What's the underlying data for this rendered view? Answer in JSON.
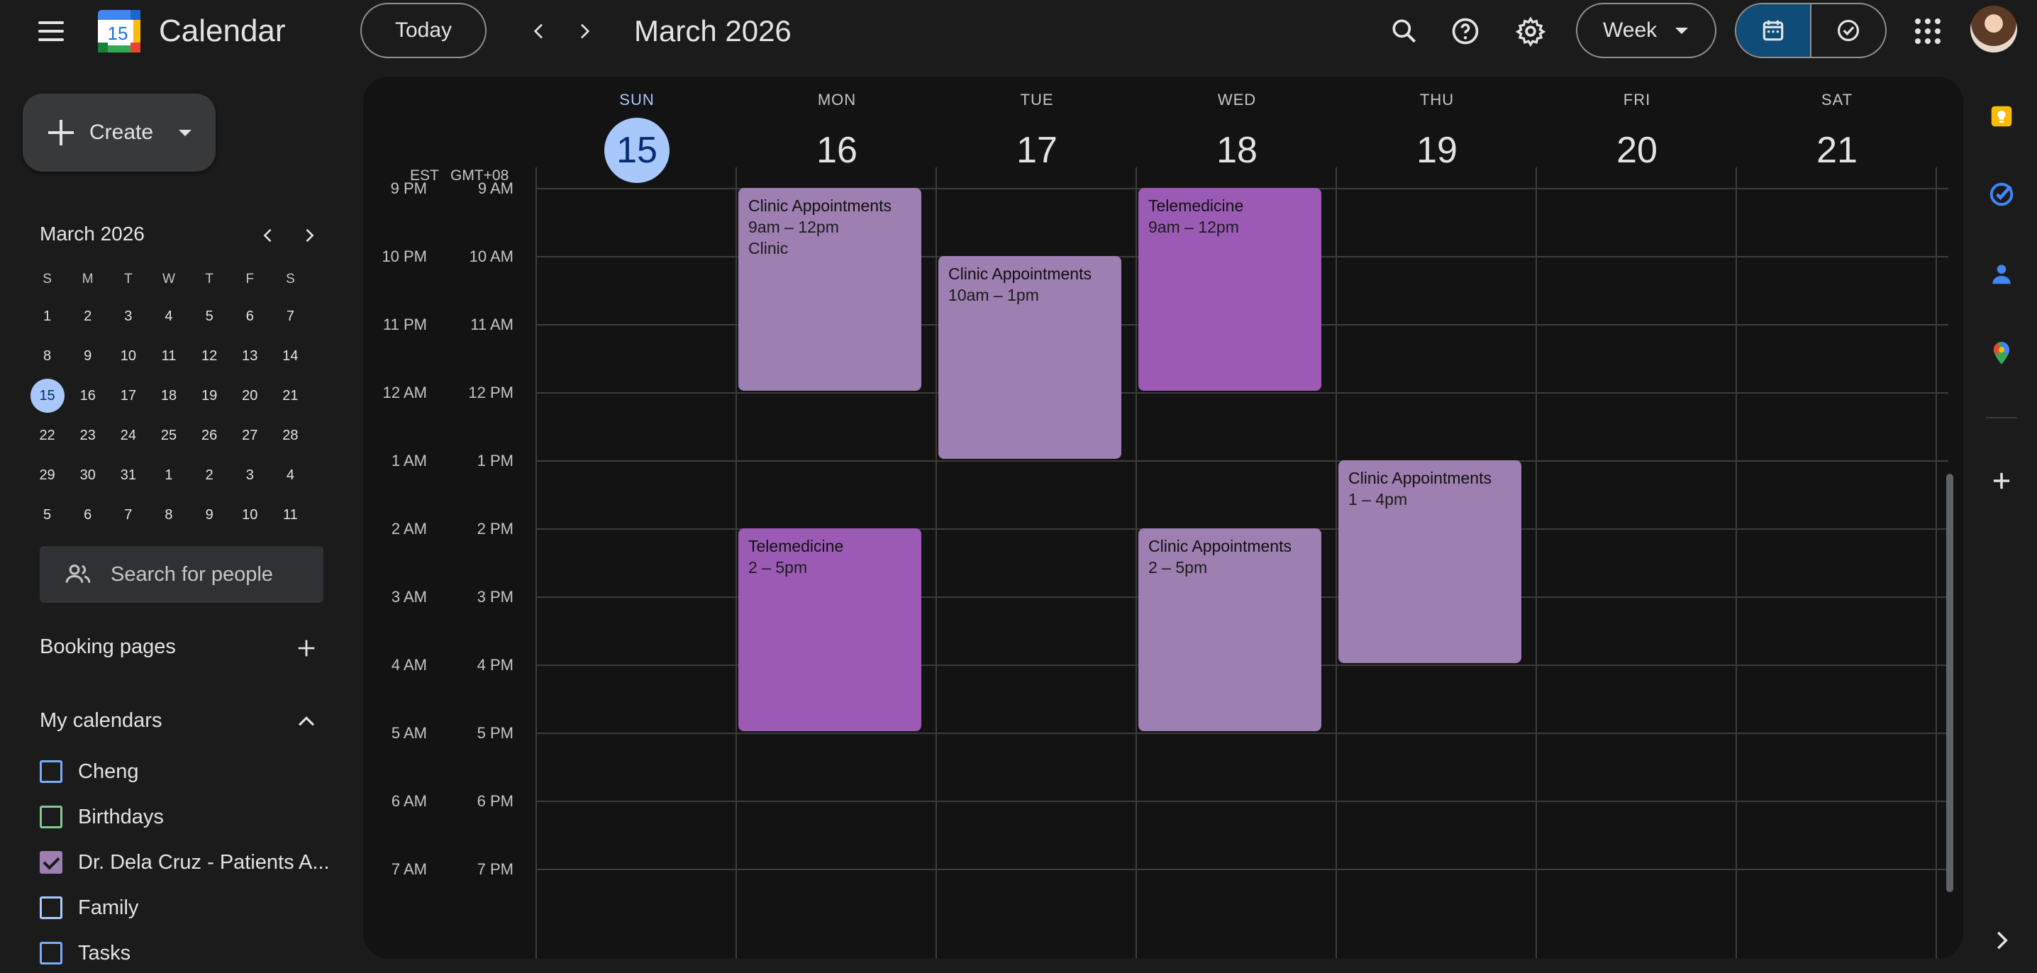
{
  "header": {
    "app_title": "Calendar",
    "logo_day": "15",
    "today_label": "Today",
    "period_title": "March 2026",
    "view_label": "Week",
    "icons": [
      "menu-icon",
      "search-icon",
      "help-icon",
      "settings-icon",
      "calendar-view-icon",
      "tasks-view-icon",
      "apps-grid-icon"
    ]
  },
  "sidebar": {
    "create_label": "Create",
    "mini_calendar": {
      "title": "March 2026",
      "weekdays": [
        "S",
        "M",
        "T",
        "W",
        "T",
        "F",
        "S"
      ],
      "weeks": [
        [
          "1",
          "2",
          "3",
          "4",
          "5",
          "6",
          "7"
        ],
        [
          "8",
          "9",
          "10",
          "11",
          "12",
          "13",
          "14"
        ],
        [
          "15",
          "16",
          "17",
          "18",
          "19",
          "20",
          "21"
        ],
        [
          "22",
          "23",
          "24",
          "25",
          "26",
          "27",
          "28"
        ],
        [
          "29",
          "30",
          "31",
          "1",
          "2",
          "3",
          "4"
        ],
        [
          "5",
          "6",
          "7",
          "8",
          "9",
          "10",
          "11"
        ]
      ],
      "today": "15"
    },
    "search_people_placeholder": "Search for people",
    "booking_pages_label": "Booking pages",
    "my_calendars_label": "My calendars",
    "calendars": [
      {
        "name": "Cheng",
        "color": "#7cacf8",
        "checked": false
      },
      {
        "name": "Birthdays",
        "color": "#81c995",
        "checked": false
      },
      {
        "name": "Dr. Dela Cruz - Patients A...",
        "color": "#9d7fb1",
        "checked": true
      },
      {
        "name": "Family",
        "color": "#aecbfa",
        "checked": false
      },
      {
        "name": "Tasks",
        "color": "#7cacf8",
        "checked": false
      }
    ]
  },
  "week": {
    "days": [
      {
        "dow": "SUN",
        "num": "15",
        "today": true
      },
      {
        "dow": "MON",
        "num": "16",
        "today": false
      },
      {
        "dow": "TUE",
        "num": "17",
        "today": false
      },
      {
        "dow": "WED",
        "num": "18",
        "today": false
      },
      {
        "dow": "THU",
        "num": "19",
        "today": false
      },
      {
        "dow": "FRI",
        "num": "20",
        "today": false
      },
      {
        "dow": "SAT",
        "num": "21",
        "today": false
      }
    ],
    "timezones": [
      "EST",
      "GMT+08"
    ],
    "hours_est": [
      "9 PM",
      "10 PM",
      "11 PM",
      "12 AM",
      "1 AM",
      "2 AM",
      "3 AM",
      "4 AM",
      "5 AM",
      "6 AM",
      "7 AM"
    ],
    "hours_local": [
      "9 AM",
      "10 AM",
      "11 AM",
      "12 PM",
      "1 PM",
      "2 PM",
      "3 PM",
      "4 PM",
      "5 PM",
      "6 PM",
      "7 PM"
    ],
    "events": [
      {
        "day": 1,
        "start": 9,
        "end": 12,
        "title": "Clinic Appointments",
        "time": "9am – 12pm",
        "location": "Clinic",
        "kind": "clinic"
      },
      {
        "day": 2,
        "start": 10,
        "end": 13,
        "title": "Clinic Appointments",
        "time": "10am – 1pm",
        "location": "",
        "kind": "clinic"
      },
      {
        "day": 3,
        "start": 9,
        "end": 12,
        "title": "Telemedicine",
        "time": "9am – 12pm",
        "location": "",
        "kind": "tele"
      },
      {
        "day": 4,
        "start": 13,
        "end": 16,
        "title": "Clinic Appointments",
        "time": "1 – 4pm",
        "location": "",
        "kind": "clinic"
      },
      {
        "day": 1,
        "start": 14,
        "end": 17,
        "title": "Telemedicine",
        "time": "2 – 5pm",
        "location": "",
        "kind": "tele"
      },
      {
        "day": 3,
        "start": 14,
        "end": 17,
        "title": "Clinic Appointments",
        "time": "2 – 5pm",
        "location": "",
        "kind": "clinic"
      }
    ],
    "first_hour": 9,
    "colors": {
      "clinic": "#9d7fb1",
      "telemedicine": "#9b5bb5",
      "today_accent": "#a8c7fa"
    }
  },
  "right_rail": {
    "icons": [
      "keep-icon",
      "tasks-icon",
      "contacts-icon",
      "maps-icon",
      "add-icon",
      "expand-icon"
    ]
  }
}
